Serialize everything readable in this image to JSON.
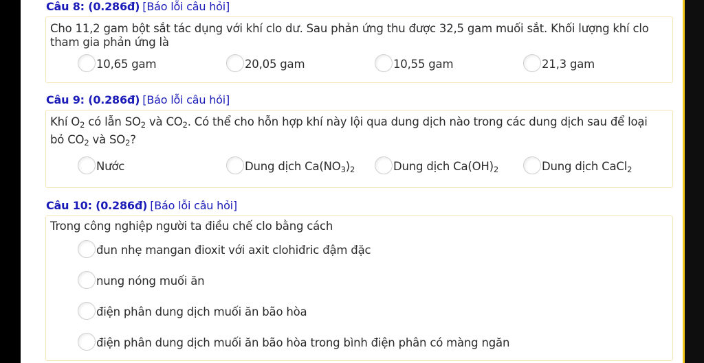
{
  "questions": [
    {
      "number": "Câu 8: (0.286đ)",
      "report": "[Báo lỗi câu hỏi]",
      "text_line1": "Cho 11,2 gam bột sắt tác dụng với khí clo dư. Sau phản ứng thu được 32,5 gam muối sắt. Khối lượng khí clo",
      "text_line2": "tham gia phản ứng là",
      "options": [
        "10,65 gam",
        "20,05 gam",
        "10,55 gam",
        "21,3 gam"
      ]
    },
    {
      "number": "Câu 9: (0.286đ)",
      "report": "[Báo lỗi câu hỏi]",
      "text_line1_parts": [
        "Khí O",
        "2",
        " có lẫn SO",
        "2",
        " và CO",
        "2",
        ". Có thể cho hỗn hợp khí này lội qua dung dịch nào trong các dung dịch sau để loại"
      ],
      "text_line2_parts": [
        "bỏ CO",
        "2",
        " và SO",
        "2",
        "?"
      ],
      "options": [
        {
          "parts": [
            "Nước"
          ]
        },
        {
          "parts": [
            "Dung dịch Ca(NO",
            "3",
            ")",
            "2"
          ]
        },
        {
          "parts": [
            "Dung dịch Ca(OH)",
            "2"
          ]
        },
        {
          "parts": [
            "Dung dịch CaCl",
            "2"
          ]
        }
      ]
    },
    {
      "number": "Câu 10: (0.286đ)",
      "report": "[Báo lỗi câu hỏi]",
      "text_line1": "Trong công nghiệp người ta điều chế clo bằng cách",
      "options": [
        "đun nhẹ mangan đioxit với axit clohiđric đậm đặc",
        "nung nóng muối ăn",
        "điện phân dung dịch muối ăn bão hòa",
        "điện phân dung dịch muối ăn bão hòa trong bình điện phân có màng ngăn"
      ]
    }
  ],
  "colors": {
    "question_header": "#1a1ab8",
    "card_border": "#f4e6b4",
    "scroll_accent": "#f0c419",
    "text": "#2b2b2b"
  }
}
